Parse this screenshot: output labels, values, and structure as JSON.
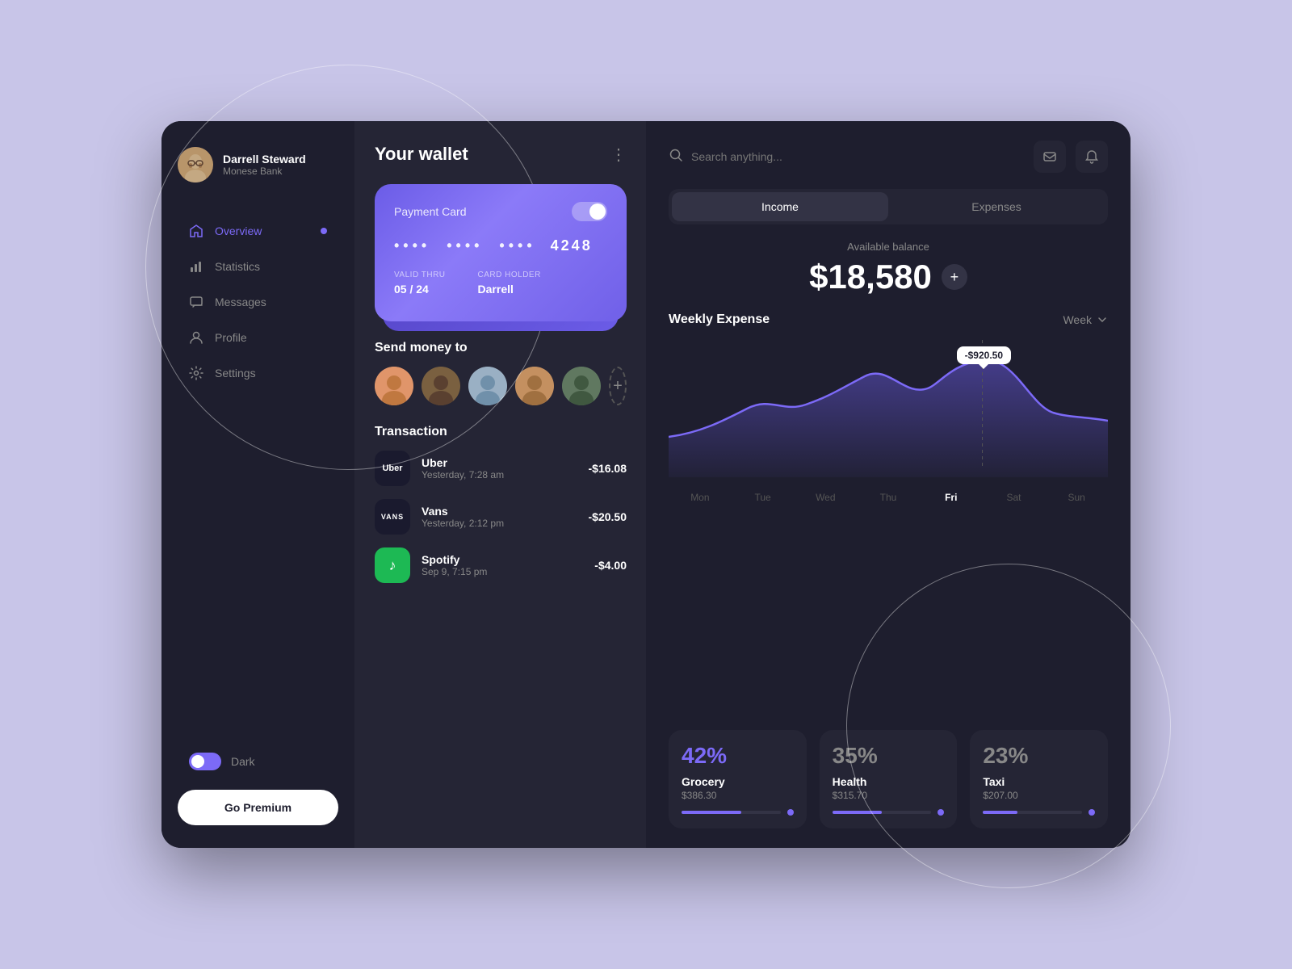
{
  "user": {
    "name": "Darrell Steward",
    "bank": "Monese Bank"
  },
  "sidebar": {
    "nav_items": [
      {
        "id": "overview",
        "label": "Overview",
        "active": true
      },
      {
        "id": "statistics",
        "label": "Statistics",
        "active": false
      },
      {
        "id": "messages",
        "label": "Messages",
        "active": false
      },
      {
        "id": "profile",
        "label": "Profile",
        "active": false
      },
      {
        "id": "settings",
        "label": "Settings",
        "active": false
      }
    ],
    "dark_label": "Dark",
    "premium_label": "Go Premium"
  },
  "wallet": {
    "title": "Your wallet",
    "card": {
      "label": "Payment Card",
      "number_dots": "•••• •••• ••••",
      "last_four": "4248",
      "valid_thru_label": "VALID THRU",
      "valid_thru": "05 / 24",
      "card_holder_label": "CARD HOLDER",
      "card_holder": "Darrell"
    },
    "send_money_title": "Send money to",
    "transactions_title": "Transaction",
    "transactions": [
      {
        "id": "uber",
        "name": "Uber",
        "date": "Yesterday, 7:28 am",
        "amount": "-$16.08",
        "icon_text": "Uber",
        "icon_color": "#1a1a2e"
      },
      {
        "id": "vans",
        "name": "Vans",
        "date": "Yesterday, 2:12 pm",
        "amount": "-$20.50",
        "icon_text": "VANS",
        "icon_color": "#1a1a2e"
      },
      {
        "id": "spotify",
        "name": "Spotify",
        "date": "Sep 9, 7:15 pm",
        "amount": "-$4.00",
        "icon_text": "♪",
        "icon_color": "#1db954"
      }
    ]
  },
  "balance": {
    "income_label": "Income",
    "expenses_label": "Expenses",
    "available_balance_label": "Available balance",
    "amount": "$18,580",
    "add_label": "+"
  },
  "chart": {
    "title": "Weekly Expense",
    "period_label": "Week",
    "tooltip": "-$920.50",
    "days": [
      "Mon",
      "Tue",
      "Wed",
      "Thu",
      "Fri",
      "Sat",
      "Sun"
    ],
    "active_day": "Fri"
  },
  "stats": [
    {
      "id": "grocery",
      "percentage": "42%",
      "name": "Grocery",
      "amount": "$386.30",
      "fill_width": "60",
      "color": "purple"
    },
    {
      "id": "health",
      "percentage": "35%",
      "name": "Health",
      "amount": "$315.70",
      "fill_width": "50",
      "color": "gray"
    },
    {
      "id": "taxi",
      "percentage": "23%",
      "name": "Taxi",
      "amount": "$207.00",
      "fill_width": "35",
      "color": "gray"
    }
  ],
  "search": {
    "placeholder": "Search anything..."
  }
}
